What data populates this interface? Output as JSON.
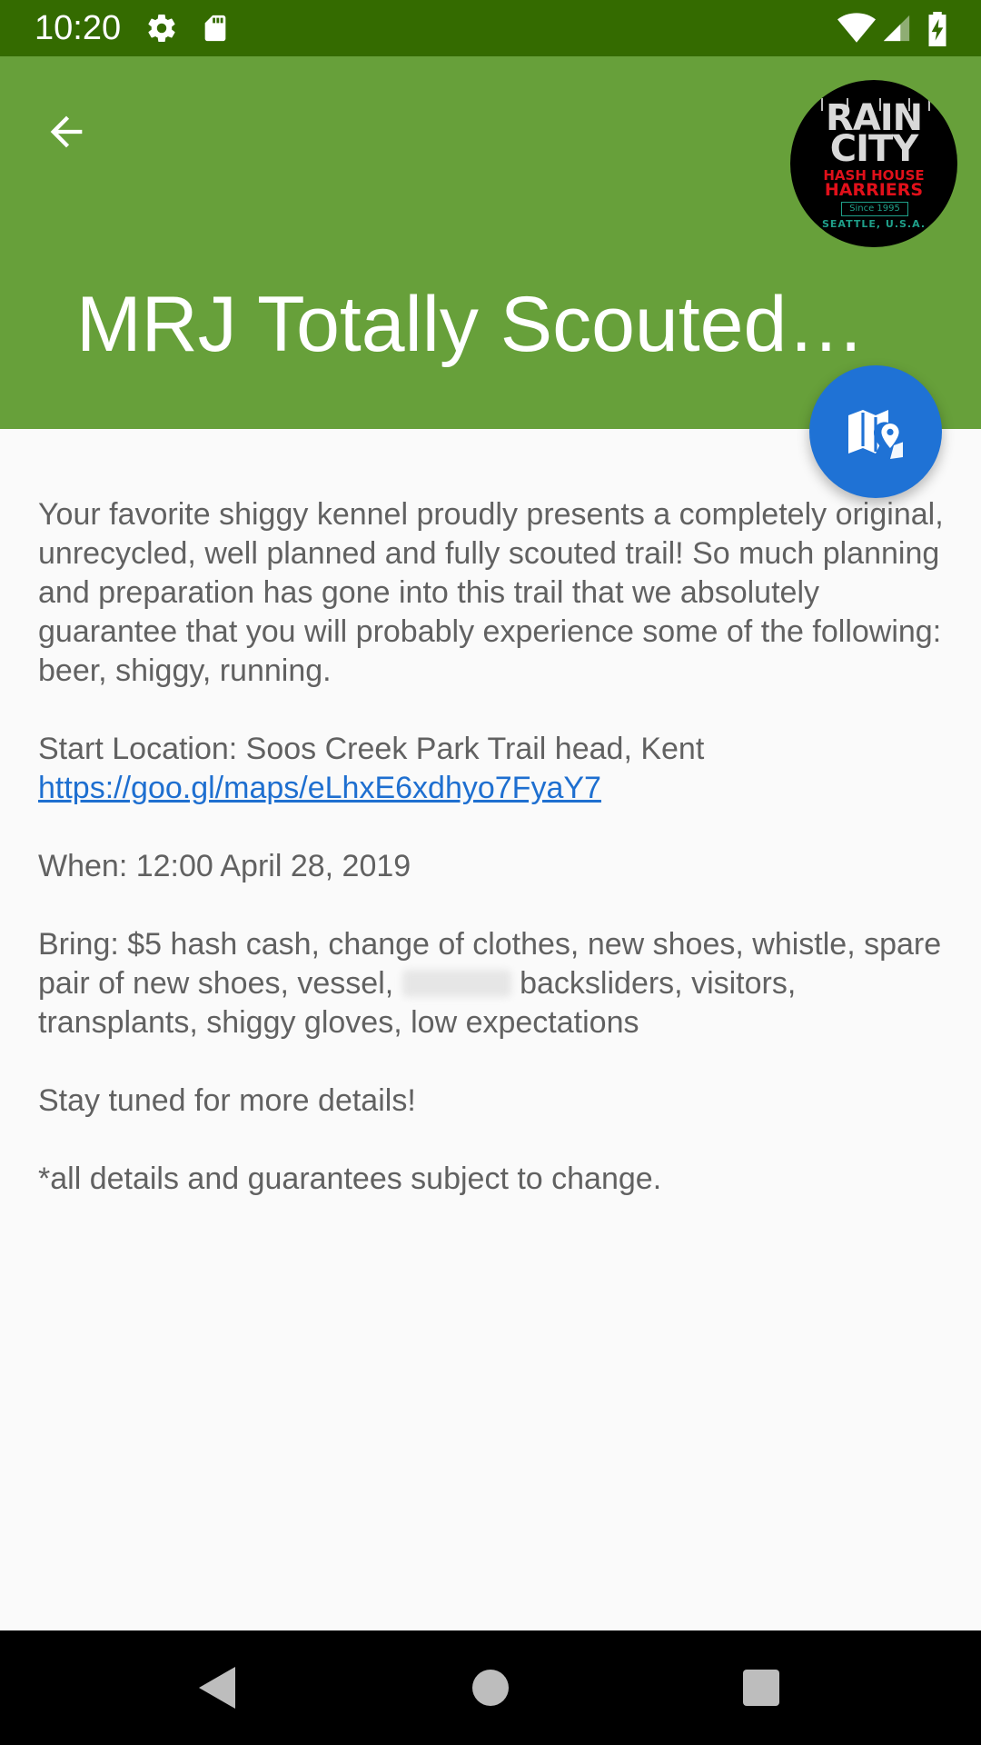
{
  "status_bar": {
    "time": "10:20",
    "icons": [
      "gear-icon",
      "sd-card-icon",
      "wifi-icon",
      "signal-icon",
      "battery-charging-icon"
    ]
  },
  "app_bar": {
    "title": "MRJ Totally Scouted Trail",
    "back_icon": "arrow-back-icon",
    "logo": {
      "line1": "RAIN",
      "line2": "CITY",
      "line3": "HASH HOUSE",
      "line4": "HARRIERS",
      "line5": "Since 1995",
      "line6": "SEATTLE, U.S.A."
    },
    "color": "#67a03a"
  },
  "fab": {
    "icon": "map-icon",
    "color": "#1f72d5"
  },
  "event": {
    "description": "Your favorite shiggy kennel proudly presents a completely original, unrecycled, well planned and fully scouted trail! So much planning and preparation has gone into this trail that we absolutely guarantee that you will probably experience some of the following: beer, shiggy, running.",
    "start_location": "Start Location: Soos Creek Park Trail head, Kent",
    "map_link": "https://goo.gl/maps/eLhxE6xdhyo7FyaY7",
    "when": "When: 12:00 April 28, 2019",
    "bring_before": "Bring: $5 hash cash, change of clothes, new shoes, whistle, spare pair of new shoes, vessel,",
    "bring_after": "backsliders, visitors, transplants, shiggy gloves, low expectations",
    "stay_tuned": "Stay tuned for more details!",
    "disclaimer": "*all details and guarantees subject to change."
  },
  "nav_bar": {
    "icons": [
      "nav-back-icon",
      "nav-home-icon",
      "nav-recents-icon"
    ]
  }
}
